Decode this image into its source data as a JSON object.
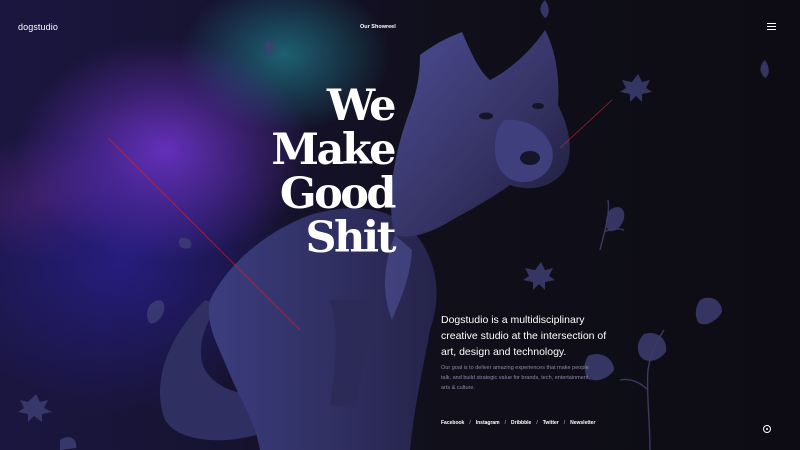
{
  "header": {
    "logo": "dogstudio",
    "showreel_link": "Our Showreel",
    "menu_icon": "hamburger-menu-icon"
  },
  "hero": {
    "headline_lines": [
      "We",
      "Make",
      "Good",
      "Shit"
    ],
    "intro": "Dogstudio is a multidisciplinary creative studio at the intersection of art, design and technology.",
    "goal": "Our goal is to deliver amazing experiences that make people talk, and build strategic value for brands, tech, entertainment, arts & culture."
  },
  "social": {
    "links": [
      "Facebook",
      "Instagram",
      "Dribbble",
      "Twitter",
      "Newsletter"
    ],
    "separator": "/"
  },
  "colors": {
    "background": "#0d0c14",
    "accent_purple": "#7636d6",
    "accent_teal": "#24a0aa",
    "laser_red": "#c0263a",
    "text_primary": "#ffffff",
    "text_muted": "#8d8aa6"
  },
  "decor": {
    "hero_image": "blue-wolf-sculpture",
    "leaf_icon": "leaf-icon",
    "scroll_indicator": "scroll-dot-icon"
  }
}
